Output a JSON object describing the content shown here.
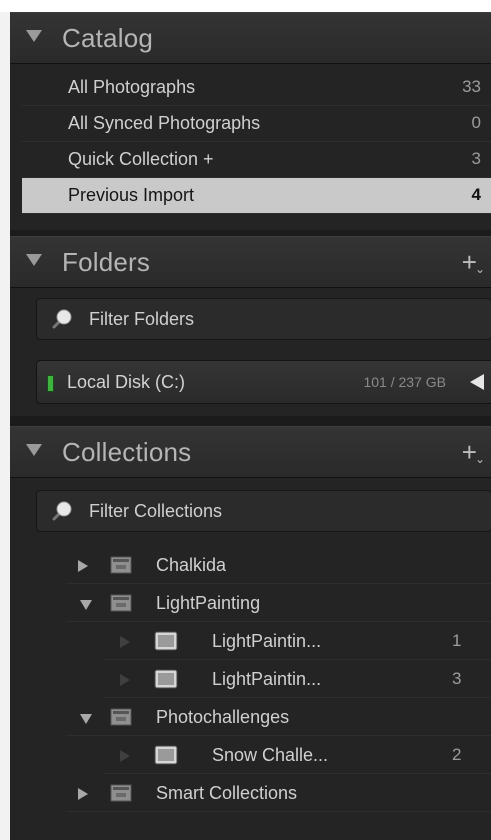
{
  "catalog": {
    "title": "Catalog",
    "items": [
      {
        "label": "All Photographs",
        "count": "33"
      },
      {
        "label": "All Synced Photographs",
        "count": "0"
      },
      {
        "label": "Quick Collection  +",
        "count": "3"
      },
      {
        "label": "Previous Import",
        "count": "4"
      }
    ]
  },
  "folders": {
    "title": "Folders",
    "add_label": "+",
    "filter_label": "Filter Folders",
    "disk": {
      "label": "Local Disk (C:)",
      "size": "101 / 237 GB"
    }
  },
  "collections": {
    "title": "Collections",
    "add_label": "+",
    "filter_label": "Filter Collections",
    "items": [
      {
        "label": "Chalkida",
        "count": ""
      },
      {
        "label": "LightPainting",
        "count": ""
      },
      {
        "label": "LightPaintin...",
        "count": "1"
      },
      {
        "label": "LightPaintin...",
        "count": "3"
      },
      {
        "label": "Photochallenges",
        "count": ""
      },
      {
        "label": "Snow Challe...",
        "count": "2"
      },
      {
        "label": "Smart Collections",
        "count": ""
      }
    ]
  },
  "colors": {
    "selected_row": "#c9c9c9",
    "panel_bg": "#242424",
    "header_bg": "#2f2f2f",
    "led": "#3fb33f"
  }
}
